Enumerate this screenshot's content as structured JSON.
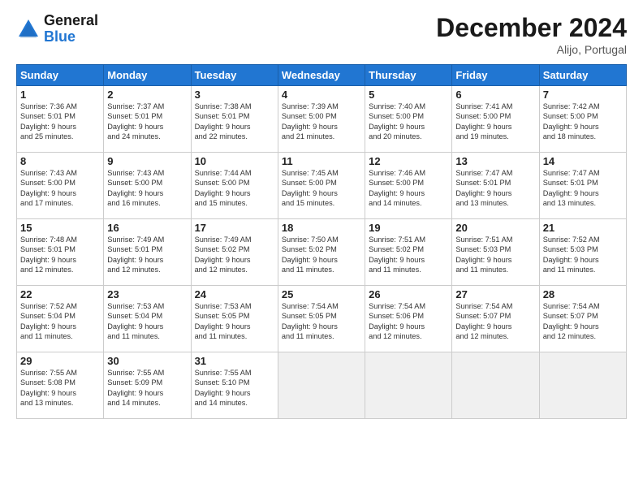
{
  "header": {
    "logo_general": "General",
    "logo_blue": "Blue",
    "title": "December 2024",
    "location": "Alijo, Portugal"
  },
  "weekdays": [
    "Sunday",
    "Monday",
    "Tuesday",
    "Wednesday",
    "Thursday",
    "Friday",
    "Saturday"
  ],
  "weeks": [
    [
      {
        "day": "1",
        "info": "Sunrise: 7:36 AM\nSunset: 5:01 PM\nDaylight: 9 hours\nand 25 minutes."
      },
      {
        "day": "2",
        "info": "Sunrise: 7:37 AM\nSunset: 5:01 PM\nDaylight: 9 hours\nand 24 minutes."
      },
      {
        "day": "3",
        "info": "Sunrise: 7:38 AM\nSunset: 5:01 PM\nDaylight: 9 hours\nand 22 minutes."
      },
      {
        "day": "4",
        "info": "Sunrise: 7:39 AM\nSunset: 5:00 PM\nDaylight: 9 hours\nand 21 minutes."
      },
      {
        "day": "5",
        "info": "Sunrise: 7:40 AM\nSunset: 5:00 PM\nDaylight: 9 hours\nand 20 minutes."
      },
      {
        "day": "6",
        "info": "Sunrise: 7:41 AM\nSunset: 5:00 PM\nDaylight: 9 hours\nand 19 minutes."
      },
      {
        "day": "7",
        "info": "Sunrise: 7:42 AM\nSunset: 5:00 PM\nDaylight: 9 hours\nand 18 minutes."
      }
    ],
    [
      {
        "day": "8",
        "info": "Sunrise: 7:43 AM\nSunset: 5:00 PM\nDaylight: 9 hours\nand 17 minutes."
      },
      {
        "day": "9",
        "info": "Sunrise: 7:43 AM\nSunset: 5:00 PM\nDaylight: 9 hours\nand 16 minutes."
      },
      {
        "day": "10",
        "info": "Sunrise: 7:44 AM\nSunset: 5:00 PM\nDaylight: 9 hours\nand 15 minutes."
      },
      {
        "day": "11",
        "info": "Sunrise: 7:45 AM\nSunset: 5:00 PM\nDaylight: 9 hours\nand 15 minutes."
      },
      {
        "day": "12",
        "info": "Sunrise: 7:46 AM\nSunset: 5:00 PM\nDaylight: 9 hours\nand 14 minutes."
      },
      {
        "day": "13",
        "info": "Sunrise: 7:47 AM\nSunset: 5:01 PM\nDaylight: 9 hours\nand 13 minutes."
      },
      {
        "day": "14",
        "info": "Sunrise: 7:47 AM\nSunset: 5:01 PM\nDaylight: 9 hours\nand 13 minutes."
      }
    ],
    [
      {
        "day": "15",
        "info": "Sunrise: 7:48 AM\nSunset: 5:01 PM\nDaylight: 9 hours\nand 12 minutes."
      },
      {
        "day": "16",
        "info": "Sunrise: 7:49 AM\nSunset: 5:01 PM\nDaylight: 9 hours\nand 12 minutes."
      },
      {
        "day": "17",
        "info": "Sunrise: 7:49 AM\nSunset: 5:02 PM\nDaylight: 9 hours\nand 12 minutes."
      },
      {
        "day": "18",
        "info": "Sunrise: 7:50 AM\nSunset: 5:02 PM\nDaylight: 9 hours\nand 11 minutes."
      },
      {
        "day": "19",
        "info": "Sunrise: 7:51 AM\nSunset: 5:02 PM\nDaylight: 9 hours\nand 11 minutes."
      },
      {
        "day": "20",
        "info": "Sunrise: 7:51 AM\nSunset: 5:03 PM\nDaylight: 9 hours\nand 11 minutes."
      },
      {
        "day": "21",
        "info": "Sunrise: 7:52 AM\nSunset: 5:03 PM\nDaylight: 9 hours\nand 11 minutes."
      }
    ],
    [
      {
        "day": "22",
        "info": "Sunrise: 7:52 AM\nSunset: 5:04 PM\nDaylight: 9 hours\nand 11 minutes."
      },
      {
        "day": "23",
        "info": "Sunrise: 7:53 AM\nSunset: 5:04 PM\nDaylight: 9 hours\nand 11 minutes."
      },
      {
        "day": "24",
        "info": "Sunrise: 7:53 AM\nSunset: 5:05 PM\nDaylight: 9 hours\nand 11 minutes."
      },
      {
        "day": "25",
        "info": "Sunrise: 7:54 AM\nSunset: 5:05 PM\nDaylight: 9 hours\nand 11 minutes."
      },
      {
        "day": "26",
        "info": "Sunrise: 7:54 AM\nSunset: 5:06 PM\nDaylight: 9 hours\nand 12 minutes."
      },
      {
        "day": "27",
        "info": "Sunrise: 7:54 AM\nSunset: 5:07 PM\nDaylight: 9 hours\nand 12 minutes."
      },
      {
        "day": "28",
        "info": "Sunrise: 7:54 AM\nSunset: 5:07 PM\nDaylight: 9 hours\nand 12 minutes."
      }
    ],
    [
      {
        "day": "29",
        "info": "Sunrise: 7:55 AM\nSunset: 5:08 PM\nDaylight: 9 hours\nand 13 minutes."
      },
      {
        "day": "30",
        "info": "Sunrise: 7:55 AM\nSunset: 5:09 PM\nDaylight: 9 hours\nand 14 minutes."
      },
      {
        "day": "31",
        "info": "Sunrise: 7:55 AM\nSunset: 5:10 PM\nDaylight: 9 hours\nand 14 minutes."
      },
      null,
      null,
      null,
      null
    ]
  ]
}
